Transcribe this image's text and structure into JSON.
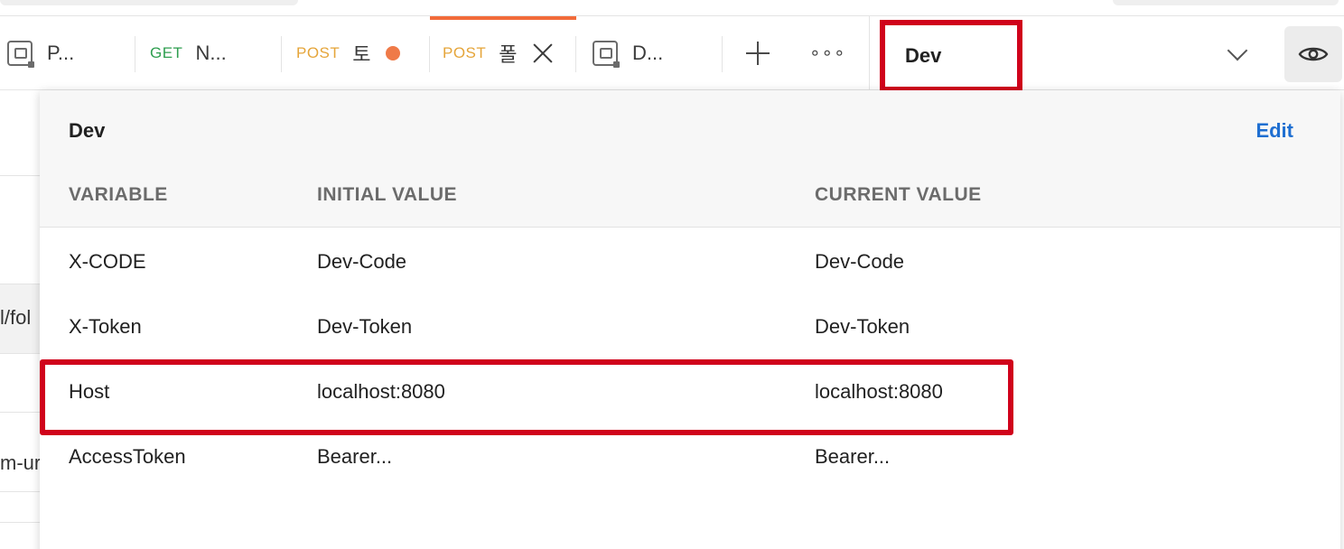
{
  "tabs": [
    {
      "method": "",
      "title": "P...",
      "icon": "request-icon"
    },
    {
      "method": "GET",
      "title": "N...",
      "icon": ""
    },
    {
      "method": "POST",
      "title": "토",
      "icon": "unsaved-dot"
    },
    {
      "method": "POST",
      "title": "폴",
      "icon": "close-icon",
      "active": true
    },
    {
      "method": "",
      "title": "D...",
      "icon": "request-icon"
    }
  ],
  "toolbar": {
    "new_tab_icon": "plus-icon",
    "more_icon": "more-icon",
    "more_glyph": "∘∘∘",
    "environment": "Dev",
    "dropdown_icon": "chevron-down-icon",
    "quicklook_icon": "eye-icon"
  },
  "background": {
    "url_fragment": "l/fol",
    "text_fragment": "m-ur"
  },
  "environment_popover": {
    "title": "Dev",
    "edit_label": "Edit",
    "columns": [
      "VARIABLE",
      "INITIAL VALUE",
      "CURRENT VALUE"
    ],
    "rows": [
      {
        "variable": "X-CODE",
        "initial": "Dev-Code",
        "current": "Dev-Code"
      },
      {
        "variable": "X-Token",
        "initial": "Dev-Token",
        "current": "Dev-Token"
      },
      {
        "variable": "Host",
        "initial": "localhost:8080",
        "current": "localhost:8080"
      },
      {
        "variable": "AccessToken",
        "initial": "Bearer...",
        "current": "Bearer..."
      }
    ]
  },
  "colors": {
    "highlight": "#d0021b",
    "active_tab": "#f26b3a",
    "get": "#2e9e4f",
    "post": "#e5a53a",
    "edit_link": "#1f6fd1"
  }
}
